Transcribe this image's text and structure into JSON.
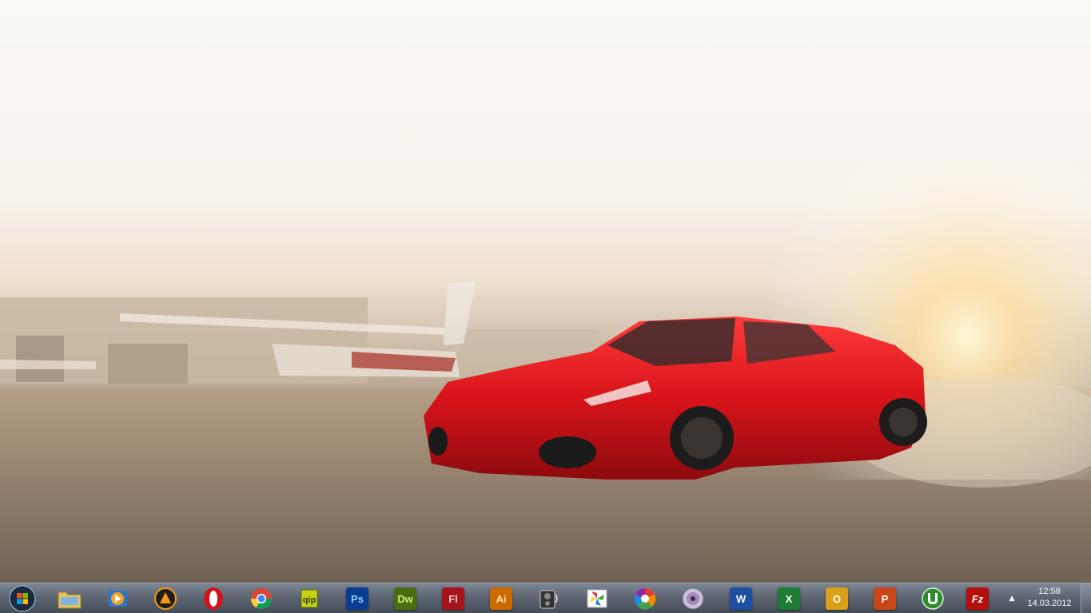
{
  "taskbar": {
    "start_button": {
      "icon": "windows-logo-icon"
    },
    "pinned_apps": [
      {
        "name": "windows-explorer",
        "icon": "folder-icon"
      },
      {
        "name": "windows-media-player",
        "icon": "media-player-icon"
      },
      {
        "name": "aimp",
        "icon": "aimp-icon"
      },
      {
        "name": "opera",
        "icon": "opera-icon"
      },
      {
        "name": "chrome",
        "icon": "chrome-icon"
      },
      {
        "name": "qip",
        "icon": "qip-icon"
      },
      {
        "name": "photoshop",
        "icon": "photoshop-icon",
        "label": "Ps",
        "color": "#0a3d91"
      },
      {
        "name": "dreamweaver",
        "icon": "dreamweaver-icon",
        "label": "Dw",
        "color": "#4d6b11"
      },
      {
        "name": "flash",
        "icon": "flash-icon",
        "label": "Fl",
        "color": "#a5141c"
      },
      {
        "name": "illustrator",
        "icon": "illustrator-icon",
        "label": "Ai",
        "color": "#cc6a00"
      },
      {
        "name": "speakers",
        "icon": "speaker-icon"
      },
      {
        "name": "picasa-like-app",
        "icon": "pinwheel-icon"
      },
      {
        "name": "picasa",
        "icon": "picasa-icon"
      },
      {
        "name": "dvd-app",
        "icon": "disc-icon"
      },
      {
        "name": "word",
        "icon": "word-icon",
        "label": "W",
        "color": "#1f4fa3"
      },
      {
        "name": "excel",
        "icon": "excel-icon",
        "label": "X",
        "color": "#1e7b34"
      },
      {
        "name": "outlook",
        "icon": "outlook-icon",
        "label": "O",
        "color": "#d9a11a"
      },
      {
        "name": "powerpoint",
        "icon": "powerpoint-icon",
        "label": "P",
        "color": "#c8461a"
      },
      {
        "name": "utorrent",
        "icon": "utorrent-icon"
      },
      {
        "name": "filezilla",
        "icon": "filezilla-icon",
        "label": "Fz",
        "color": "#b30f0f"
      }
    ],
    "tray": {
      "show_hidden_icon": "up-arrow-icon",
      "time": "12:58",
      "date": "14.03.2012"
    }
  }
}
